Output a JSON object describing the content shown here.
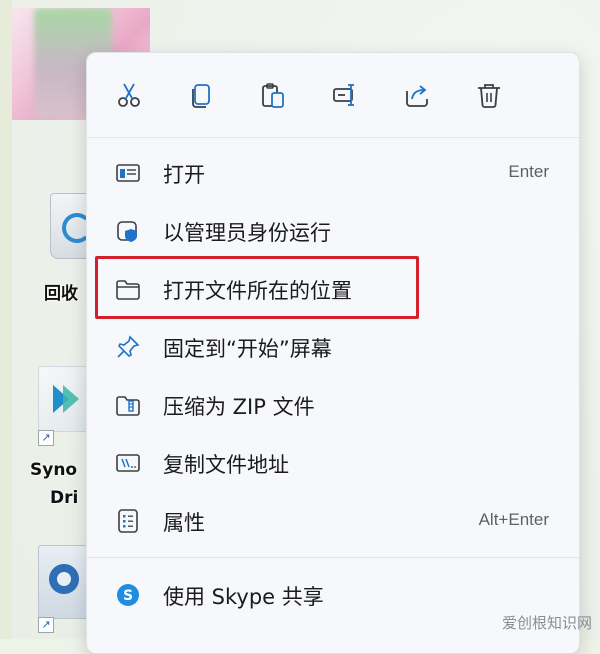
{
  "desktop": {
    "recycle_label": "回收",
    "syno_label_line1": "Syno",
    "syno_label_line2": "Dri"
  },
  "toolbar": {
    "buttons": [
      {
        "name": "cut",
        "icon": "scissors-icon"
      },
      {
        "name": "copy",
        "icon": "copy-icon"
      },
      {
        "name": "paste",
        "icon": "paste-icon"
      },
      {
        "name": "rename",
        "icon": "rename-icon"
      },
      {
        "name": "share",
        "icon": "share-icon"
      },
      {
        "name": "delete",
        "icon": "trash-icon"
      }
    ]
  },
  "menu": {
    "items": [
      {
        "label": "打开",
        "shortcut": "Enter",
        "icon": "open-window-icon"
      },
      {
        "label": "以管理员身份运行",
        "shortcut": "",
        "icon": "shield-icon"
      },
      {
        "label": "打开文件所在的位置",
        "shortcut": "",
        "icon": "folder-icon"
      },
      {
        "label": "固定到“开始”屏幕",
        "shortcut": "",
        "icon": "pin-icon"
      },
      {
        "label": "压缩为 ZIP 文件",
        "shortcut": "",
        "icon": "zip-folder-icon"
      },
      {
        "label": "复制文件地址",
        "shortcut": "",
        "icon": "copy-path-icon"
      },
      {
        "label": "属性",
        "shortcut": "Alt+Enter",
        "icon": "properties-icon"
      },
      {
        "label": "使用 Skype 共享",
        "shortcut": "",
        "icon": "skype-icon"
      }
    ]
  },
  "colors": {
    "highlight": "#d3202a",
    "accent": "#1f73c8"
  },
  "watermark": "爱创根知识网"
}
